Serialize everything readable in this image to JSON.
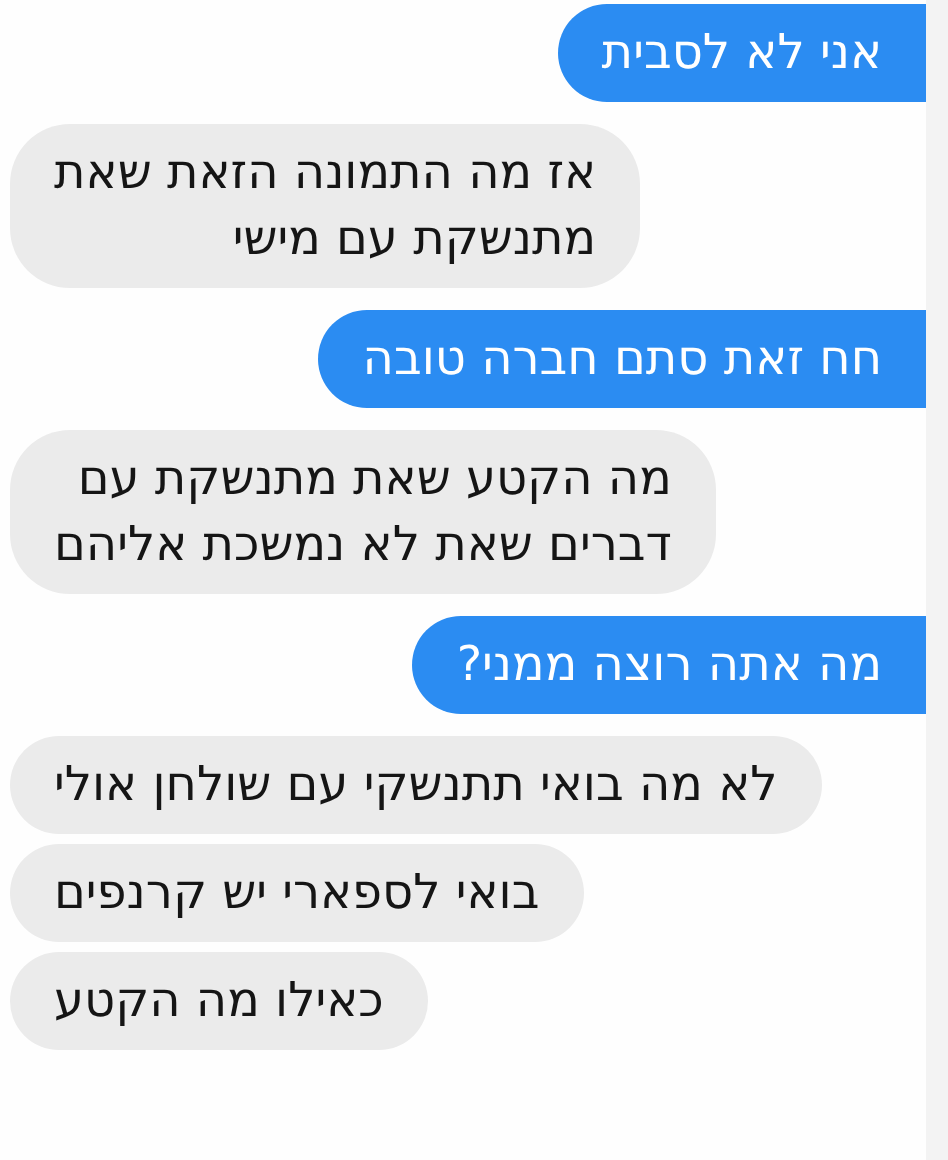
{
  "messages": [
    {
      "kind": "sent",
      "text": "אני לא לסבית"
    },
    {
      "kind": "received",
      "text": "אז מה התמונה הזאת שאת\nמתנשקת עם מישי"
    },
    {
      "kind": "sent",
      "text": "חח זאת סתם חברה טובה"
    },
    {
      "kind": "received",
      "text": "מה הקטע שאת מתנשקת עם\nדברים שאת לא נמשכת אליהם"
    },
    {
      "kind": "sent",
      "text": "מה אתה רוצה ממני?"
    },
    {
      "kind": "received",
      "text": "לא מה בואי תתנשקי עם שולחן אולי"
    },
    {
      "kind": "received",
      "text": "בואי לספארי יש קרנפים"
    },
    {
      "kind": "received",
      "text": "כאילו מה הקטע"
    }
  ]
}
